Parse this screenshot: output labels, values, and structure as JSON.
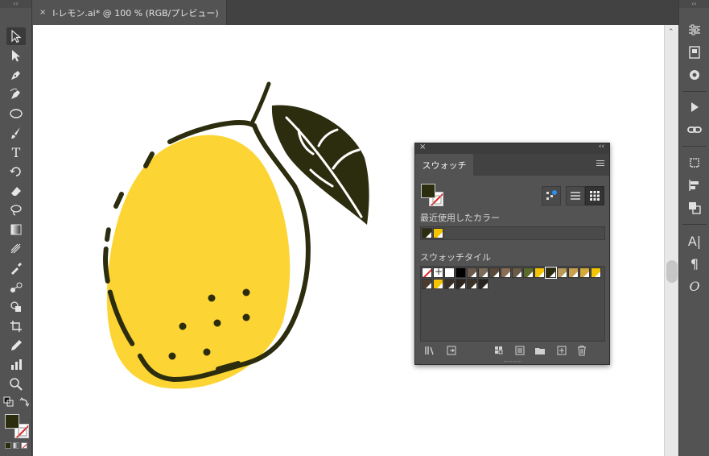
{
  "document_tab": {
    "close_symbol": "×",
    "title": "l-レモン.ai* @ 100 % (RGB/プレビュー)"
  },
  "toolbar": {
    "tools": [
      {
        "name": "selection-tool",
        "icon": "arrow-outline"
      },
      {
        "name": "direct-selection-tool",
        "icon": "arrow-filled"
      },
      {
        "name": "pen-tool",
        "icon": "pen"
      },
      {
        "name": "curvature-tool",
        "icon": "curvature-pen"
      },
      {
        "name": "ellipse-tool",
        "icon": "ellipse"
      },
      {
        "name": "paintbrush-tool",
        "icon": "brush"
      },
      {
        "name": "type-tool",
        "icon": "T"
      },
      {
        "name": "rotate-tool",
        "icon": "rotate"
      },
      {
        "name": "eraser-tool",
        "icon": "eraser"
      },
      {
        "name": "lasso-tool",
        "icon": "lasso"
      },
      {
        "name": "gradient-tool",
        "icon": "gradient"
      },
      {
        "name": "mesh-tool",
        "icon": "mesh"
      },
      {
        "name": "eyedropper-tool",
        "icon": "eyedropper"
      },
      {
        "name": "blend-tool",
        "icon": "blend"
      },
      {
        "name": "shape-builder-tool",
        "icon": "shape-builder"
      },
      {
        "name": "crop-tool",
        "icon": "crop"
      },
      {
        "name": "pencil-tool",
        "icon": "pencil"
      },
      {
        "name": "graph-tool",
        "icon": "graph"
      },
      {
        "name": "zoom-tool",
        "icon": "magnifier"
      }
    ],
    "fill_color": "#2c2d0e"
  },
  "swatches_panel": {
    "tab_label": "スウォッチ",
    "recent_label": "最近使用したカラー",
    "library_label": "スウォッチタイル",
    "fill_color": "#2c2d0e",
    "recent_colors": [
      "#2c2d0e",
      "#f5c400"
    ],
    "swatches_row1": [
      "none",
      "registration",
      "#ffffff",
      "#000000",
      "#6b5a4e",
      "#7d6b5a",
      "#5a4a3c",
      "#8b6d55",
      "#6a5a48",
      "#5c6b2a",
      "#f5c400",
      "#2c2d0e",
      "#b5985a",
      "#c8a050",
      "#d4a83a",
      "#f5c400"
    ],
    "swatches_row2": [
      "#4a3d30",
      "#f5c400",
      "#3a3028",
      "#2c2520",
      "#3b3228",
      "#2a2420"
    ]
  },
  "canvas": {
    "lemon_fill": "#fcd534",
    "outline_color": "#2c2d0e",
    "leaf_color": "#2c2d0e"
  }
}
